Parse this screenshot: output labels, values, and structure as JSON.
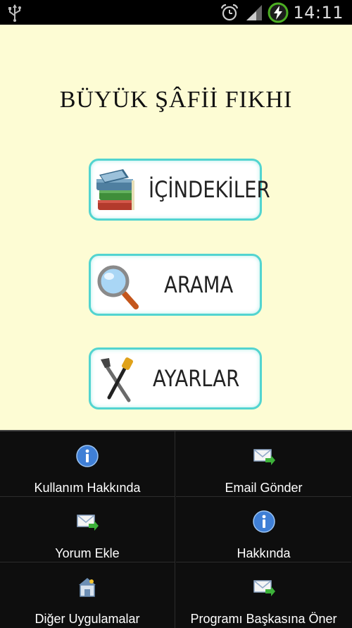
{
  "status_bar": {
    "time": "14:11",
    "icons": [
      "usb-icon",
      "alarm-icon",
      "signal-icon",
      "battery-charging-icon"
    ]
  },
  "app": {
    "title": "BÜYÜK ŞÂFİİ FIKHI",
    "buttons": [
      {
        "label": "İÇİNDEKİLER",
        "icon": "books-icon"
      },
      {
        "label": "ARAMA",
        "icon": "magnifier-icon"
      },
      {
        "label": "AYARLAR",
        "icon": "tools-icon"
      }
    ]
  },
  "menu": {
    "items": [
      {
        "label": "Kullanım Hakkında",
        "icon": "info-icon"
      },
      {
        "label": "Email Gönder",
        "icon": "email-send-icon"
      },
      {
        "label": "Yorum Ekle",
        "icon": "email-send-icon"
      },
      {
        "label": "Hakkında",
        "icon": "info-icon"
      },
      {
        "label": "Diğer Uygulamalar",
        "icon": "apps-icon"
      },
      {
        "label": "Programı Başkasına Öner",
        "icon": "email-send-icon"
      }
    ]
  },
  "colors": {
    "background": "#fdfcd4",
    "button_border": "#52d4d0",
    "menu_background": "#0e0e0e",
    "status_bar": "#000000",
    "battery_accent": "#4caf23"
  }
}
